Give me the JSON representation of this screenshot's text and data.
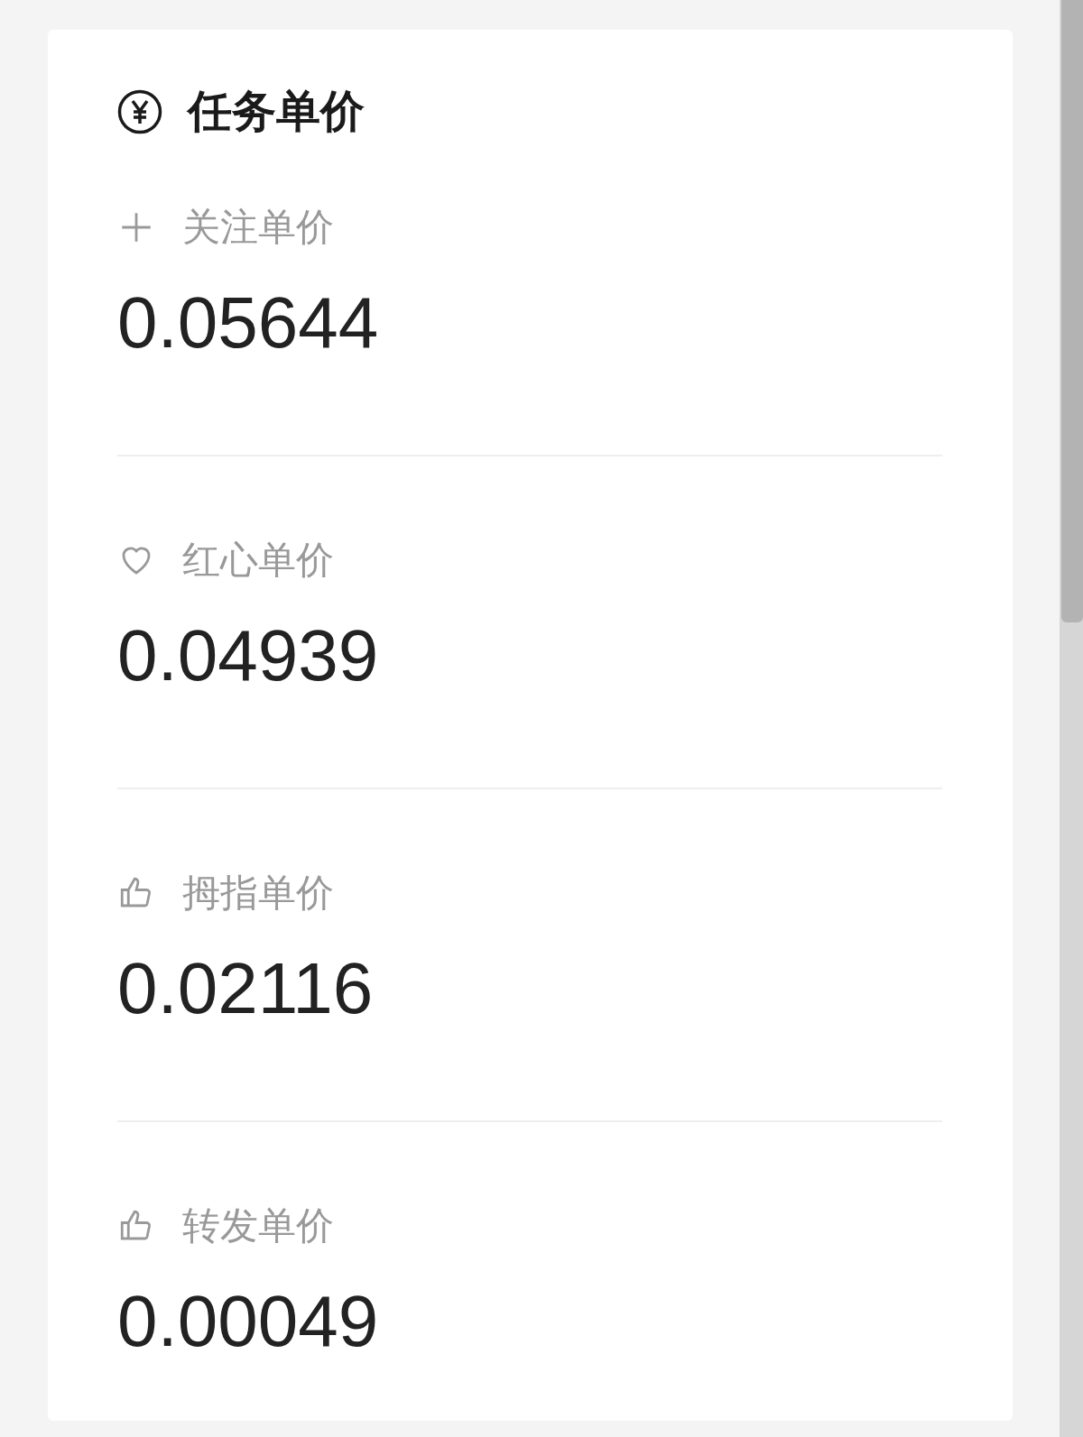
{
  "card": {
    "title": "任务单价",
    "items": [
      {
        "kind": "plus",
        "label": "关注单价",
        "value": "0.05644"
      },
      {
        "kind": "heart",
        "label": "红心单价",
        "value": "0.04939"
      },
      {
        "kind": "thumb",
        "label": "拇指单价",
        "value": "0.02116"
      },
      {
        "kind": "thumb",
        "label": "转发单价",
        "value": "0.00049"
      }
    ]
  }
}
